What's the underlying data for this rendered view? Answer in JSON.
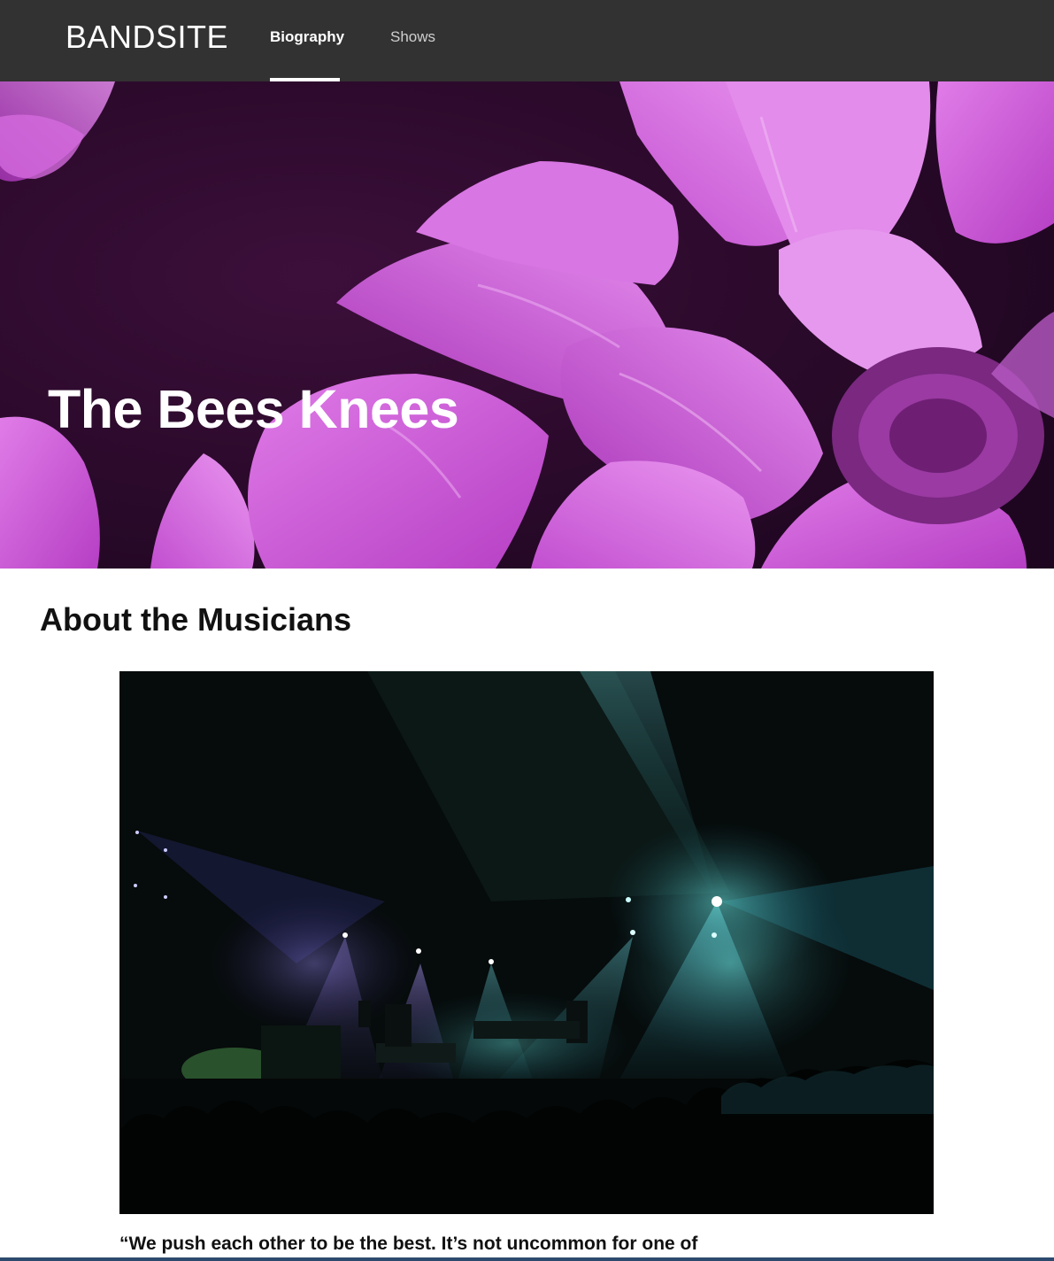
{
  "nav": {
    "logo": "BANDSITE",
    "links": [
      {
        "label": "Biography",
        "active": true
      },
      {
        "label": "Shows",
        "active": false
      }
    ]
  },
  "hero": {
    "title": "The Bees Knees",
    "image_icon": "flower-photo"
  },
  "about": {
    "heading": "About the Musicians",
    "image_icon": "concert-photo",
    "quote": "“We push each other to be the best. It’s not uncommon for one of"
  },
  "colors": {
    "nav_bg": "#323232",
    "hero_magenta": "#c95ad6",
    "text": "#111111"
  }
}
